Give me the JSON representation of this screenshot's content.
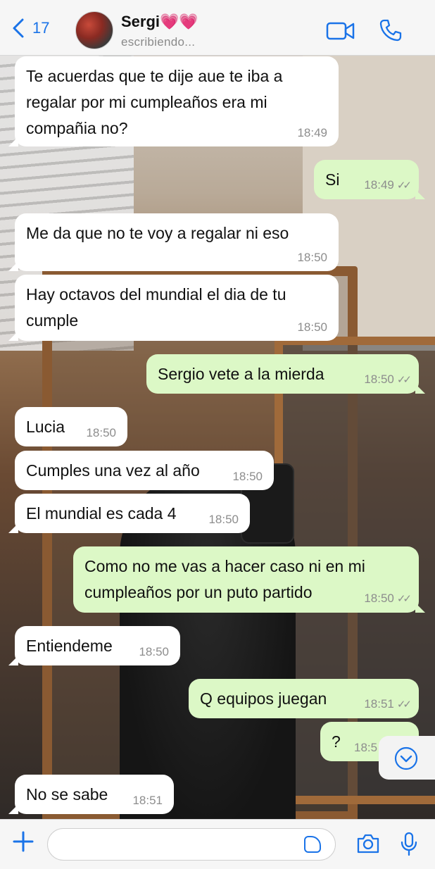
{
  "header": {
    "back_count": "17",
    "contact_name": "Sergi💗💗",
    "status": "escribiendo..."
  },
  "messages": [
    {
      "dir": "in",
      "text": "Te acuerdas que te dije aue te iba a regalar por mi cumpleaños era mi compañia no?",
      "time": "18:49"
    },
    {
      "dir": "out",
      "text": "Si",
      "time": "18:49",
      "ticks": "✓✓"
    },
    {
      "dir": "in",
      "text": "Me da que no te voy a regalar ni eso",
      "time": "18:50"
    },
    {
      "dir": "in",
      "text": "Hay octavos del mundial el dia de tu cumple",
      "time": "18:50"
    },
    {
      "dir": "out",
      "text": "Sergio vete a la mierda",
      "time": "18:50",
      "ticks": "✓✓"
    },
    {
      "dir": "in",
      "text": "Lucia",
      "time": "18:50"
    },
    {
      "dir": "in",
      "text": "Cumples una vez al año",
      "time": "18:50"
    },
    {
      "dir": "in",
      "text": "El mundial es cada 4",
      "time": "18:50"
    },
    {
      "dir": "out",
      "text": "Como no me vas a hacer caso ni en mi cumpleaños por un puto partido",
      "time": "18:50",
      "ticks": "✓✓"
    },
    {
      "dir": "in",
      "text": "Entiendeme",
      "time": "18:50"
    },
    {
      "dir": "out",
      "text": "Q equipos juegan",
      "time": "18:51",
      "ticks": "✓✓"
    },
    {
      "dir": "out",
      "text": "?",
      "time": "18:5"
    },
    {
      "dir": "in",
      "text": "No se sabe",
      "time": "18:51"
    }
  ],
  "footer": {
    "input_placeholder": ""
  },
  "colors": {
    "accent": "#1a73e8",
    "incoming_bubble": "#ffffff",
    "outgoing_bubble": "#dcf8c6"
  },
  "icons": [
    "chevron-left-icon",
    "video-call-icon",
    "phone-icon",
    "plus-icon",
    "sticker-icon",
    "camera-icon",
    "microphone-icon",
    "chevron-down-icon"
  ]
}
